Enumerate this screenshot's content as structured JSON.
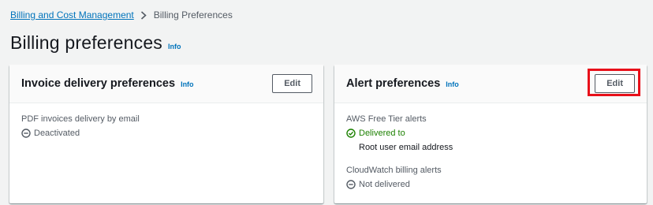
{
  "breadcrumb": {
    "root": "Billing and Cost Management",
    "current": "Billing Preferences"
  },
  "page": {
    "title": "Billing preferences",
    "info": "Info"
  },
  "invoice_card": {
    "title": "Invoice delivery preferences",
    "info": "Info",
    "edit_label": "Edit",
    "field_label": "PDF invoices delivery by email",
    "status": "Deactivated",
    "status_icon": "minus-circle-icon"
  },
  "alert_card": {
    "title": "Alert preferences",
    "info": "Info",
    "edit_label": "Edit",
    "highlight_color": "#e8101a",
    "free_tier": {
      "label": "AWS Free Tier alerts",
      "status": "Delivered to",
      "status_icon": "check-circle-icon",
      "status_color": "#1d8102",
      "recipient": "Root user email address"
    },
    "cloudwatch": {
      "label": "CloudWatch billing alerts",
      "status": "Not delivered",
      "status_icon": "minus-circle-icon"
    }
  },
  "colors": {
    "link": "#0073bb",
    "background": "#f2f3f3"
  }
}
